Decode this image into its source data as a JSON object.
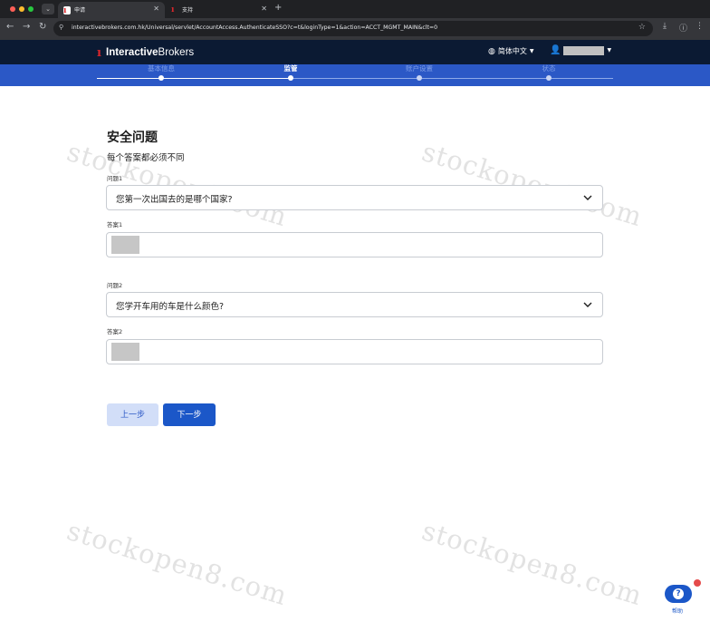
{
  "browser": {
    "tabs": [
      {
        "title": "申请",
        "active": true
      },
      {
        "title": "支持",
        "active": false
      }
    ],
    "url": "interactivebrokers.com.hk/Universal/servlet/AccountAccess.AuthenticateSSO?c=t&loginType=1&action=ACCT_MGMT_MAIN&clt=0"
  },
  "header": {
    "logo_bold": "Interactive",
    "logo_light": "Brokers",
    "language": "简体中文"
  },
  "stepper": {
    "steps": [
      {
        "label": "基本信息",
        "state": "done"
      },
      {
        "label": "监管",
        "state": "current"
      },
      {
        "label": "账户设置",
        "state": "pending"
      },
      {
        "label": "状态",
        "state": "pending"
      }
    ]
  },
  "form": {
    "title": "安全问题",
    "subtitle": "每个答案都必须不同",
    "question1_label": "问题1",
    "question1_value": "您第一次出国去的是哪个国家?",
    "answer1_label": "答案1",
    "question2_label": "问题2",
    "question2_value": "您学开车用的车是什么颜色?",
    "answer2_label": "答案2",
    "prev_label": "上一步",
    "next_label": "下一步"
  },
  "watermark": "stockopen8.com",
  "help": {
    "label": "帮助"
  },
  "colors": {
    "header_bg": "#0b1a33",
    "stepper_bg": "#2b58c6",
    "primary": "#1b57c8",
    "logo_red": "#d9262b"
  }
}
